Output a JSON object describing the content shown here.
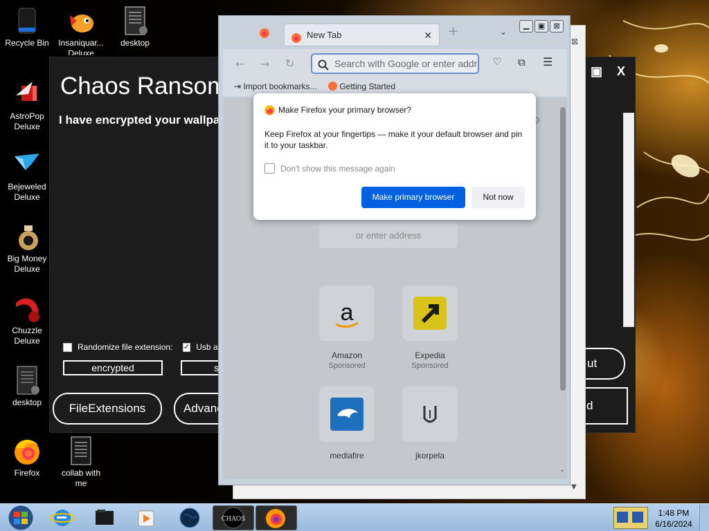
{
  "desktop": {
    "icons": [
      {
        "label": "Recycle Bin",
        "icon": "recycle-bin-icon"
      },
      {
        "label": "Insaniquar...\nDeluxe",
        "icon": "insaniquarium-icon"
      },
      {
        "label": "desktop",
        "icon": "document-icon"
      },
      {
        "label": "AstroPop\nDeluxe",
        "icon": "astropop-icon"
      },
      {
        "label": "Bejeweled\nDeluxe",
        "icon": "bejeweled-icon"
      },
      {
        "label": "Big Money\nDeluxe",
        "icon": "big-money-icon"
      },
      {
        "label": "Chuzzle\nDeluxe",
        "icon": "chuzzle-icon"
      },
      {
        "label": "desktop",
        "icon": "document-icon"
      },
      {
        "label": "Firefox",
        "icon": "firefox-icon"
      },
      {
        "label": "collab with\nme",
        "icon": "document-icon"
      }
    ]
  },
  "ransom_window": {
    "title": "Chaos Ransom",
    "subtitle": "I have encrypted your wallpa",
    "controls": {
      "maximize": "▣",
      "close": "X"
    },
    "randomize_label": "Randomize file extension:",
    "randomize_checked": false,
    "usb_label": "Usb ar",
    "usb_checked": true,
    "extension_value": "encrypted",
    "second_field_value": "s",
    "buttons": {
      "file_extensions": "FileExtensions",
      "advanced": "Advanc",
      "right_top": "ut",
      "right_bottom": "d"
    }
  },
  "firefox": {
    "tab_title": "New Tab",
    "url_placeholder": "Search with Google or enter address",
    "bookmarks": [
      {
        "label": "Import bookmarks...",
        "icon": "import-icon"
      },
      {
        "label": "Getting Started",
        "icon": "firefox-icon"
      }
    ],
    "search_hint": "or enter address",
    "shortcuts": [
      {
        "label": "Amazon",
        "sub": "Sponsored",
        "icon": "amazon-icon"
      },
      {
        "label": "Expedia",
        "sub": "Sponsored",
        "icon": "expedia-icon"
      },
      {
        "label": "mediafire",
        "sub": "",
        "icon": "mediafire-icon"
      },
      {
        "label": "jkorpela",
        "sub": "",
        "icon": "jkorpela-icon"
      }
    ]
  },
  "dialog": {
    "title": "Make Firefox your primary browser?",
    "body": "Keep Firefox at your fingertips — make it your default browser and pin it to your taskbar.",
    "checkbox_label": "Don't show this message again",
    "primary_button": "Make primary browser",
    "secondary_button": "Not now"
  },
  "taskbar": {
    "time": "1:48 PM",
    "date": "6/16/2024",
    "pinned": [
      {
        "name": "internet-explorer-icon"
      },
      {
        "name": "folder-icon"
      },
      {
        "name": "media-player-icon"
      },
      {
        "name": "globe-icon"
      },
      {
        "name": "chaos-icon",
        "label": "CHAOS"
      },
      {
        "name": "firefox-icon"
      }
    ]
  },
  "colors": {
    "dialog_primary": "#0061e0",
    "ransom_bg": "#1c1c1c"
  }
}
